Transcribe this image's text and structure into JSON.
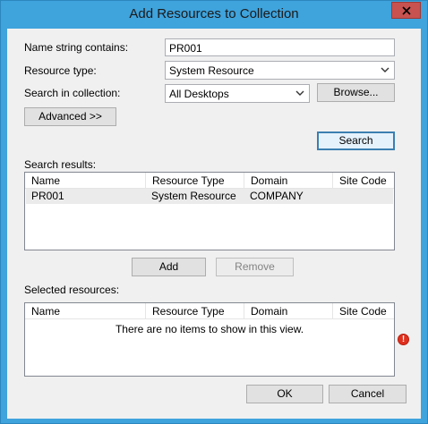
{
  "window": {
    "title": "Add Resources to Collection"
  },
  "form": {
    "name_label": "Name string contains:",
    "name_value": "PR001",
    "type_label": "Resource type:",
    "type_value": "System Resource",
    "collection_label": "Search in collection:",
    "collection_value": "All Desktops",
    "browse_label": "Browse...",
    "advanced_label": "Advanced >>",
    "search_label": "Search"
  },
  "results": {
    "label": "Search results:",
    "columns": [
      "Name",
      "Resource Type",
      "Domain",
      "Site Code"
    ],
    "rows": [
      [
        "PR001",
        "System Resource",
        "COMPANY",
        ""
      ]
    ]
  },
  "actions": {
    "add_label": "Add",
    "remove_label": "Remove"
  },
  "selected": {
    "label": "Selected resources:",
    "columns": [
      "Name",
      "Resource Type",
      "Domain",
      "Site Code"
    ],
    "empty_message": "There are no items to show in this view."
  },
  "footer": {
    "ok_label": "OK",
    "cancel_label": "Cancel"
  },
  "colors": {
    "titlebar": "#3fa3dc",
    "close_button": "#c7524f",
    "error_icon": "#e0301e"
  },
  "icons": {
    "close": "close-icon",
    "dropdown": "chevron-down-icon",
    "error": "error-icon"
  }
}
